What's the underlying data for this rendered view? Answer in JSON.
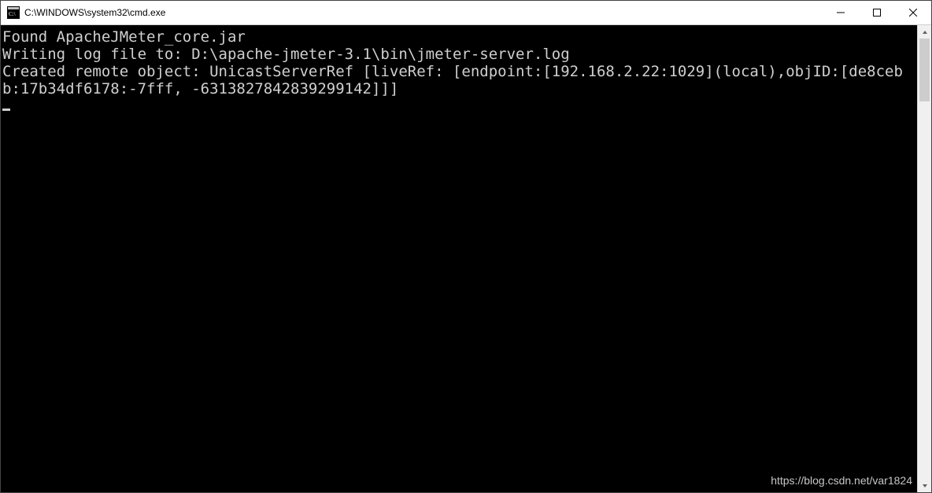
{
  "window": {
    "title": "C:\\WINDOWS\\system32\\cmd.exe"
  },
  "console": {
    "lines": [
      "Found ApacheJMeter_core.jar",
      "Writing log file to: D:\\apache-jmeter-3.1\\bin\\jmeter-server.log",
      "Created remote object: UnicastServerRef [liveRef: [endpoint:[192.168.2.22:1029](local),objID:[de8cebb:17b34df6178:-7fff, -6313827842839299142]]]"
    ]
  },
  "watermark": "https://blog.csdn.net/var1824"
}
